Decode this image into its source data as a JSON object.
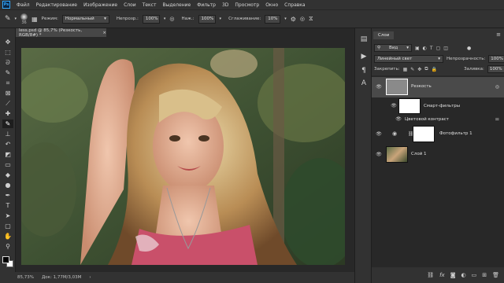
{
  "menu": {
    "logo": "Ps",
    "items": [
      "Файл",
      "Редактирование",
      "Изображение",
      "Слои",
      "Текст",
      "Выделение",
      "Фильтр",
      "3D",
      "Просмотр",
      "Окно",
      "Справка"
    ]
  },
  "options": {
    "brush_size": "36",
    "mode_label": "Режим:",
    "mode_value": "Нормальный",
    "opacity_label": "Непрозр.:",
    "opacity_value": "100%",
    "pressure_label": "Наж.:",
    "pressure_value": "100%",
    "smoothing_label": "Сглаживание:",
    "smoothing_value": "10%"
  },
  "document": {
    "tab_title": "less.psd @ 85,7% (Резкость, RGB/8#) *",
    "zoom": "85,73%",
    "doc_info": "Док: 1,77M/3,03M"
  },
  "layers_panel": {
    "tab": "Слои",
    "filter_kind": "Вид",
    "blend_mode": "Линейный свет",
    "opacity_label": "Непрозрачность:",
    "opacity_value": "100%",
    "lock_label": "Закрепить:",
    "fill_label": "Заливка:",
    "fill_value": "100%",
    "layers": [
      {
        "name": "Резкость"
      },
      {
        "name": "Смарт-фильтры"
      },
      {
        "name": "Цветовой контраст"
      },
      {
        "name": "Фотофильтр 1"
      },
      {
        "name": "Слой 1"
      }
    ]
  },
  "colors": {
    "app_bg": "#282828",
    "panel_bg": "#323232",
    "selected_layer": "#4a4a4a",
    "accent": "#31a8ff"
  }
}
